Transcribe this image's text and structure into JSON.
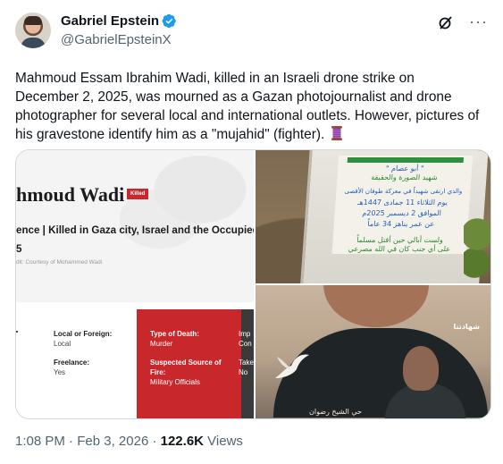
{
  "author": {
    "display_name": "Gabriel Epstein",
    "handle": "@GabrielEpsteinX"
  },
  "actions": {
    "grok_icon": "grok-icon",
    "more_icon": "more-icon",
    "more_label": "···"
  },
  "tweet": {
    "text": "Mahmoud Essam Ibrahim Wadi, killed in an Israeli drone strike on December 2, 2025, was mourned as a Gazan photojournalist and drone photographer for several local and international outlets. However, pictures of his gravestone identify him as a \"mujahid\" (fighter).",
    "emoji_icon": "thread-spool-icon"
  },
  "media": {
    "article": {
      "title": "hmoud Wadi",
      "badge": "Killed",
      "subtitle": "ence | Killed in Gaza city, Israel and the Occupied Pa",
      "digit": "5",
      "credit": "dit: Courtesy of Mohammed Wadi",
      "local_label": "Local or Foreign:",
      "local_value": "Local",
      "freelance_label": "Freelance:",
      "freelance_value": "Yes",
      "death_label": "Type of Death:",
      "death_value": "Murder",
      "source_label": "Suspected Source of Fire:",
      "source_value": "Military Officials",
      "clip_1": "Imp",
      "clip_2": "Con",
      "clip_3": "Take",
      "clip_4": "No"
    },
    "gravestone": {
      "line1": "\" أبو عصام \"",
      "line2": "شهيد الصورة والحقيقة",
      "line3": "والذي ارتقى شهيداً في معركة طوفان الأقصى",
      "line4": "يوم الثلاثاء 11 جمادى 1447هـ",
      "line5": "الموافق 2 ديسمبر 2025م",
      "line6": "عن عمر يناهز 34 عاماً",
      "line7": "ولست أبالي حين أقتل مسلماً",
      "line8": "على أي جنب كان في الله مصرعي"
    },
    "poster": {
      "logo": "شهادتنا",
      "footer": "حي الشيخ رضوان"
    }
  },
  "meta": {
    "time": "1:08 PM",
    "separator": "·",
    "date": "Feb 3, 2026",
    "views_count": "122.6K",
    "views_label": "Views"
  }
}
